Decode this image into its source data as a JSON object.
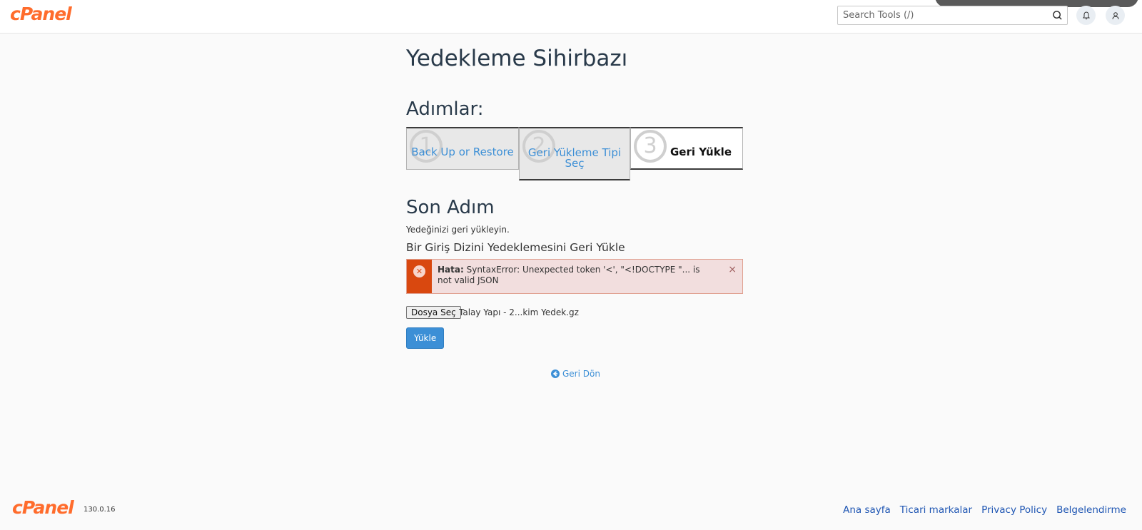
{
  "header": {
    "logo": "cPanel",
    "search_placeholder": "Search Tools (/)",
    "icons": [
      "search-icon",
      "bell-icon",
      "user-icon"
    ]
  },
  "page_title": "Yedekleme Sihirbazı",
  "steps": {
    "title": "Adımlar:",
    "items": [
      {
        "number": "1",
        "label": "Back Up or Restore"
      },
      {
        "number": "2",
        "label": "Geri Yükleme Tipi Seç"
      },
      {
        "number": "3",
        "label": "Geri Yükle"
      }
    ]
  },
  "section": {
    "title": "Son Adım",
    "description": "Yedeğinizi geri yükleyin.",
    "subtitle": "Bir Giriş Dizini Yedeklemesini Geri Yükle"
  },
  "alert": {
    "label": "Hata:",
    "message": " SyntaxError: Unexpected token '<', \"<!DOCTYPE \"... is not valid JSON",
    "close": "×",
    "color": "#d9480f"
  },
  "file": {
    "button_label": "Dosya Seç",
    "file_name": "Talay Yapı - 2...kim Yedek.gz"
  },
  "upload_button": "Yükle",
  "back_link": "Geri Dön",
  "footer": {
    "logo": "cPanel",
    "version": "130.0.16",
    "links": [
      "Ana sayfa",
      "Ticari markalar",
      "Privacy Policy",
      "Belgelendirme"
    ]
  },
  "colors": {
    "brand": "#ff6c2c",
    "link": "#3c8fd6",
    "footer_link": "#1f56b3"
  }
}
